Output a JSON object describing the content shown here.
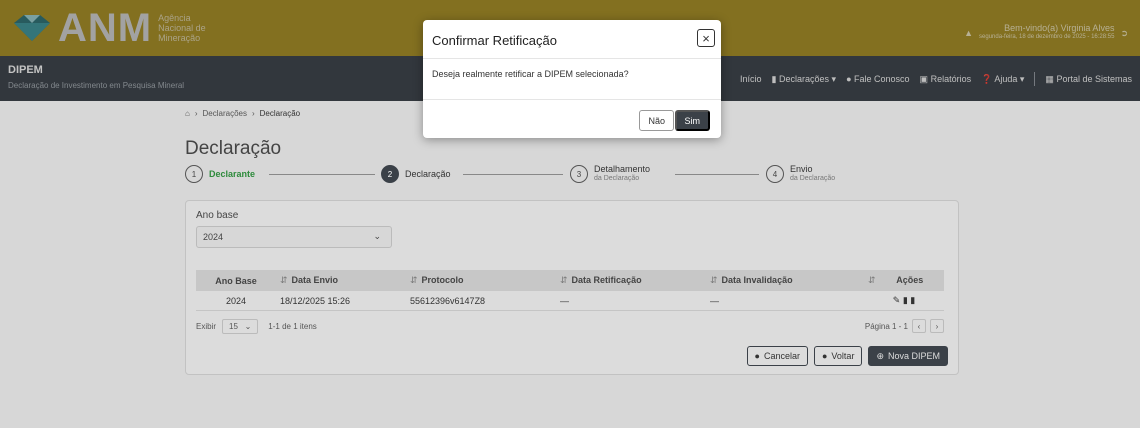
{
  "header": {
    "logo_text": "ANM",
    "agency_line1": "Agência",
    "agency_line2": "Nacional de",
    "agency_line3": "Mineração",
    "user_name": "Bem-vindo(a) Virginia Alves",
    "user_date": "segunda-feira, 18 de dezembro de 2025 - 16:28:55"
  },
  "navbar": {
    "title": "DIPEM",
    "subtitle": "Declaração de Investimento em Pesquisa Mineral",
    "menu": {
      "inicio": "Início",
      "declaracoes": "Declarações",
      "fale": "Fale Conosco",
      "relatorios": "Relatórios",
      "ajuda": "Ajuda",
      "portal": "Portal de Sistemas"
    }
  },
  "breadcrumb": {
    "item1": "Declarações",
    "item2": "Declaração"
  },
  "page_title": "Declaração",
  "stepper": {
    "s1_num": "1",
    "s1_label": "Declarante",
    "s2_num": "2",
    "s2_label": "Declaração",
    "s3_num": "3",
    "s3_label": "Detalhamento",
    "s3_sub": "da Declaração",
    "s4_num": "4",
    "s4_label": "Envio",
    "s4_sub": "da Declaração"
  },
  "form": {
    "ano_base_label": "Ano base",
    "ano_base_value": "2024"
  },
  "table": {
    "headers": [
      "Ano Base",
      "Data Envio",
      "Protocolo",
      "Data Retificação",
      "Data Invalidação",
      "Ações"
    ],
    "rows": [
      {
        "ano": "2024",
        "envio": "18/12/2025 15:26",
        "protocolo": "55612396v6147Z8",
        "retificacao": "—",
        "invalidacao": "—"
      }
    ]
  },
  "pager": {
    "exibir": "Exibir",
    "size": "15",
    "range": "1-1 de 1 itens",
    "pagina": "Página  1 - 1"
  },
  "buttons": {
    "cancelar": "Cancelar",
    "voltar": "Voltar",
    "nova": "Nova DIPEM"
  },
  "modal": {
    "title": "Confirmar Retificação",
    "close": "×",
    "body": "Deseja realmente retificar a DIPEM selecionada?",
    "no": "Não",
    "yes": "Sim"
  },
  "colors": {
    "header": "#9a8426",
    "navbar": "#3b4148",
    "accent_green": "#2e8b3c"
  }
}
